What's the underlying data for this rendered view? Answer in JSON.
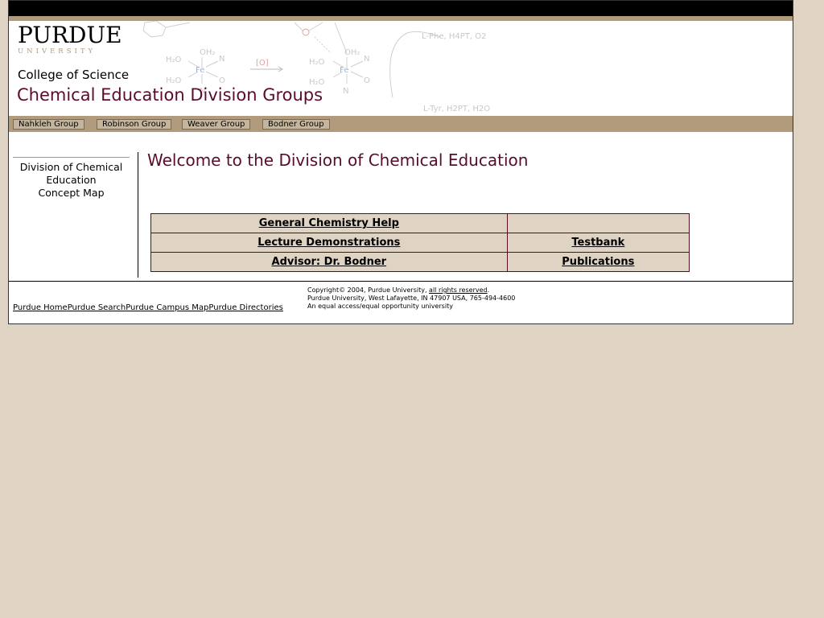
{
  "header": {
    "logo_main": "PURDUE",
    "logo_sub": "UNIVERSITY",
    "college": "College of Science",
    "division_title": "Chemical Education Division Groups"
  },
  "nav": {
    "items": [
      {
        "label": "Nahkleh Group"
      },
      {
        "label": "Robinson Group"
      },
      {
        "label": "Weaver Group"
      },
      {
        "label": "Bodner Group"
      }
    ]
  },
  "sidebar": {
    "line1": "Division of Chemical",
    "line2": "Education",
    "line3": "Concept Map"
  },
  "main": {
    "welcome": "Welcome to the Division of Chemical Education",
    "links": [
      [
        "General Chemistry Help",
        ""
      ],
      [
        "Lecture Demonstrations",
        "Testbank"
      ],
      [
        "Advisor: Dr. Bodner",
        "Publications"
      ]
    ]
  },
  "footer": {
    "links": [
      "Purdue Home",
      "Purdue Search",
      "Purdue Campus Map",
      "Purdue Directories"
    ],
    "copyright_prefix": "Copyright© 2004, Purdue University, ",
    "copyright_link": "all rights reserved",
    "copyright_suffix": ".",
    "address": "Purdue University, West Lafayette, IN 47907 USA, 765-494-4600",
    "equal": "An equal access/equal opportunity university"
  },
  "diagram": {
    "reaction_top": "L-Phe, H4PT, O2",
    "reaction_bottom": "L-Tyr, H2PT, H2O",
    "oxidant": "[O]"
  },
  "colors": {
    "page_bg": "#dfd4c4",
    "tan": "#b19b7c",
    "maroon": "#5a0c2c",
    "nav_button": "#c4b59c"
  }
}
